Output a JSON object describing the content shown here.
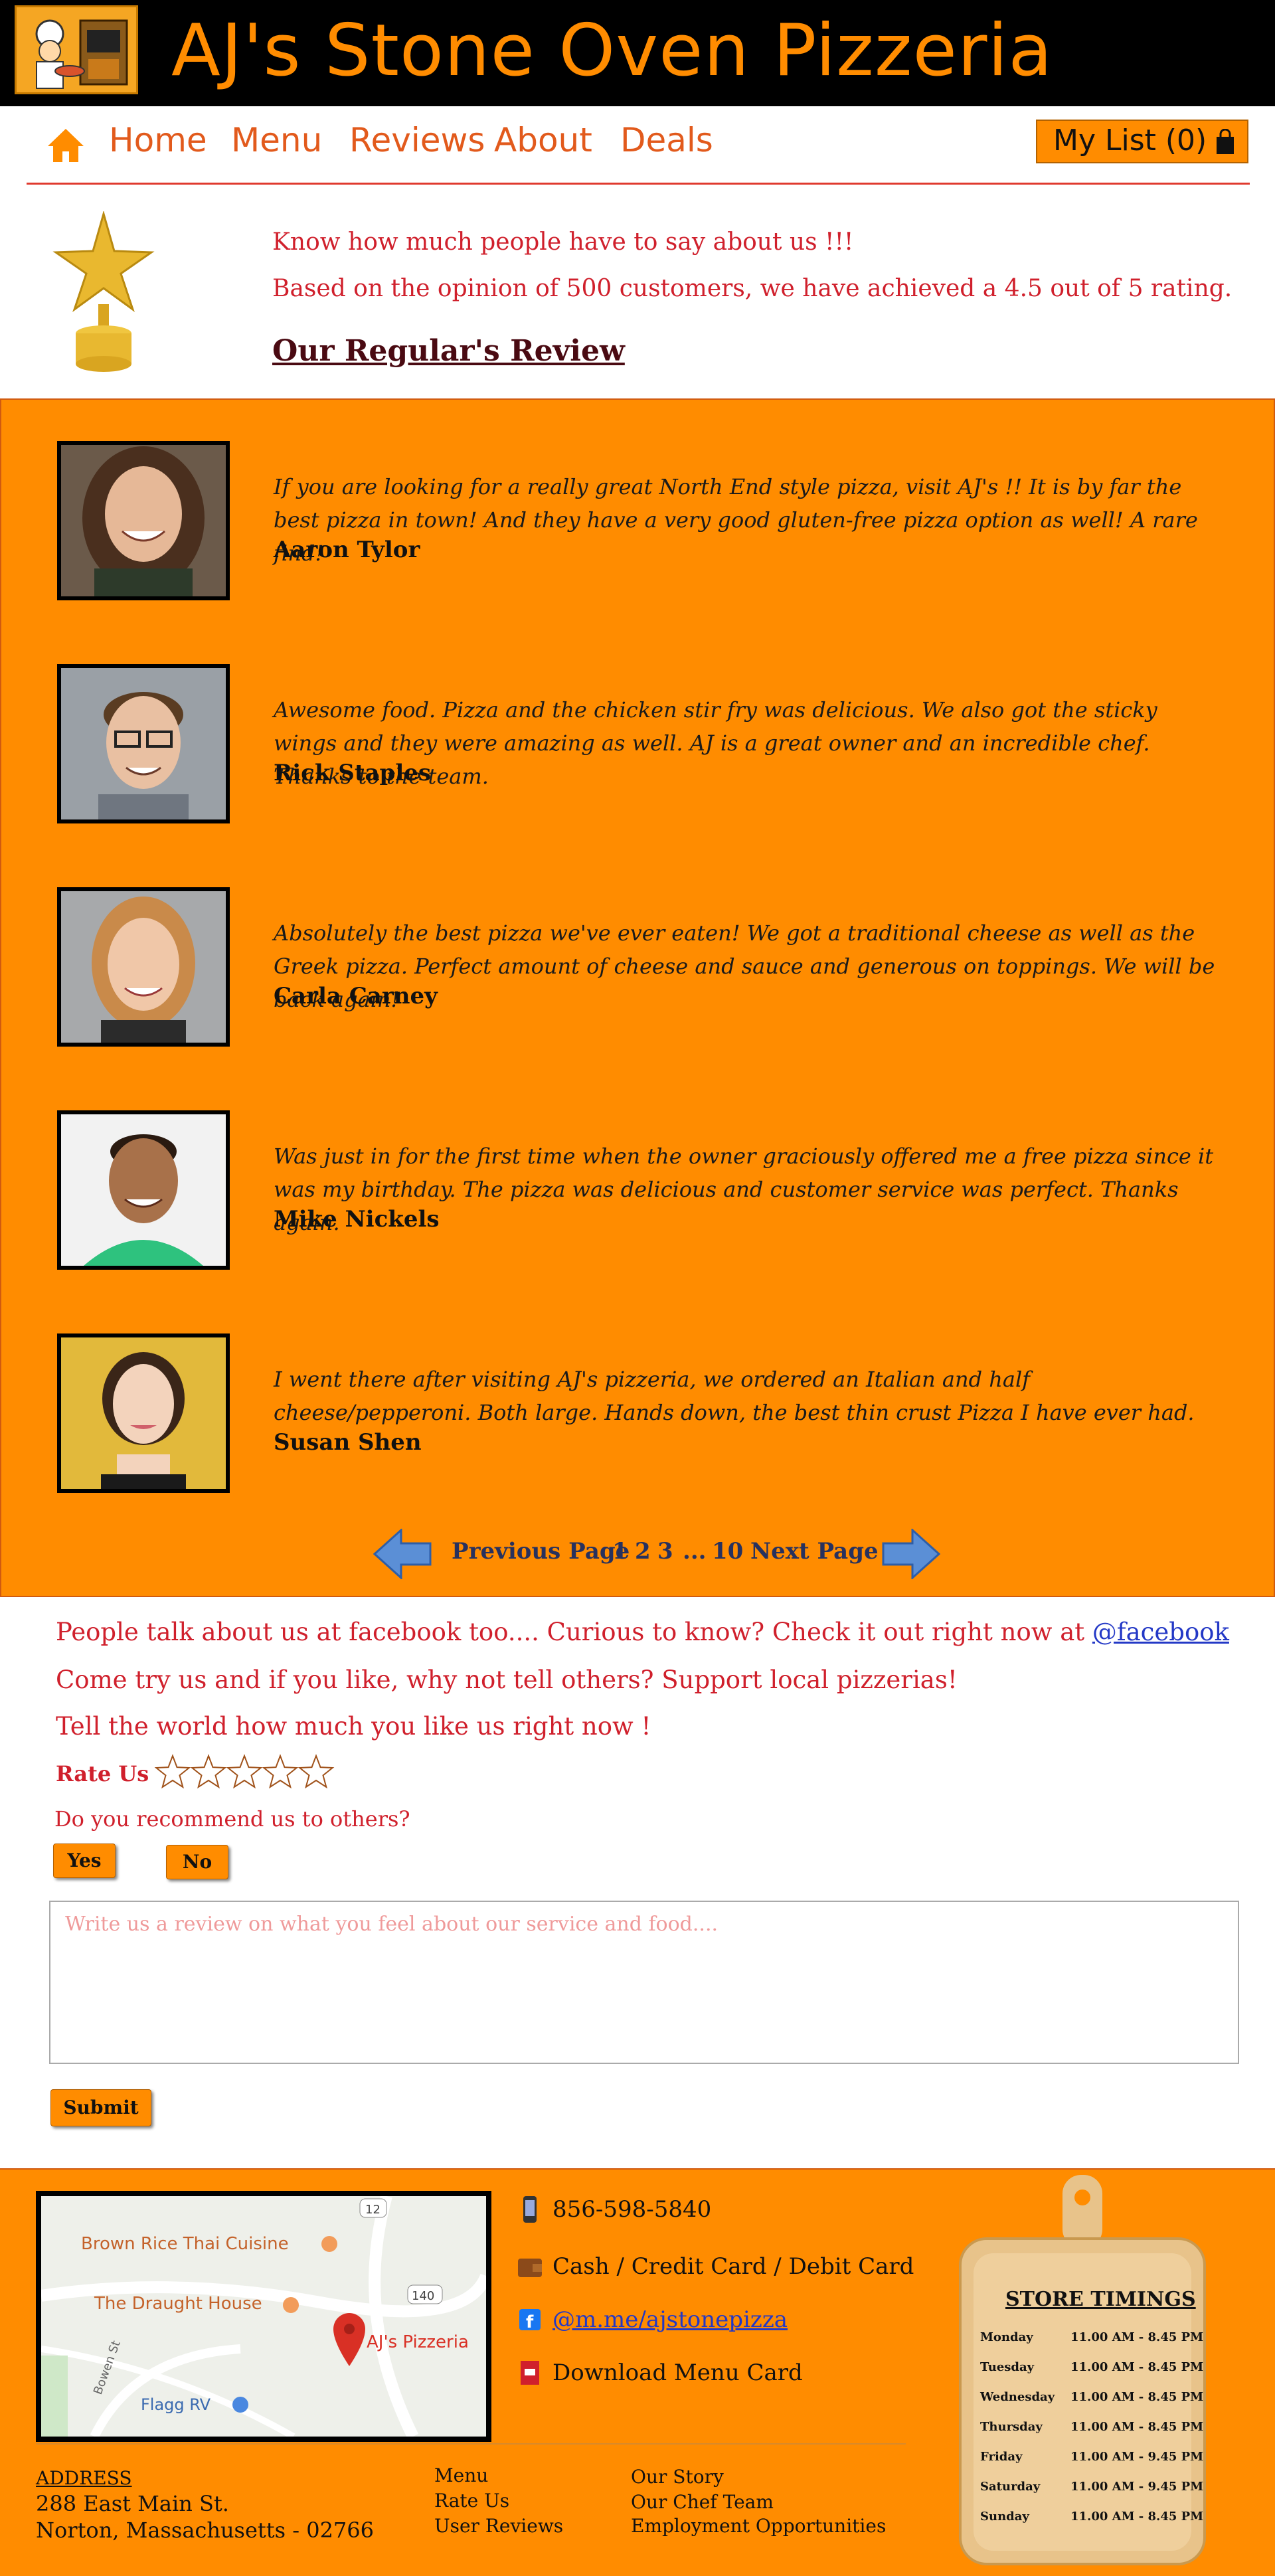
{
  "header": {
    "title": "AJ's Stone Oven Pizzeria"
  },
  "nav": {
    "items": [
      {
        "label": "Home"
      },
      {
        "label": "Menu"
      },
      {
        "label": "Reviews"
      },
      {
        "label": "About"
      },
      {
        "label": "Deals"
      }
    ],
    "my_list_label": "My List (0)"
  },
  "intro": {
    "line1": "Know how much people have to say about us !!!",
    "line2": "Based on the opinion of 500 customers, we have achieved a 4.5 out of 5 rating.",
    "section_title": "Our Regular's Review"
  },
  "reviews": [
    {
      "text": "If you are looking for a really great North End style pizza, visit AJ's !! It is by far the best pizza in town! And they have a very good gluten-free pizza option as well! A rare find!",
      "name": "Aaron Tylor"
    },
    {
      "text": "Awesome food. Pizza and the chicken stir fry was delicious. We also got the sticky wings and they were amazing as well. AJ is a great owner and an incredible chef. Thanks to the team.",
      "name": "Rick Staples"
    },
    {
      "text": "Absolutely the best pizza we've ever eaten! We got a traditional cheese as well as the Greek pizza. Perfect amount of cheese and sauce and generous on toppings. We will be back again!",
      "name": "Carla Carney"
    },
    {
      "text": "Was just in for the first time when the owner graciously offered me a free pizza since it was my birthday. The pizza was delicious and customer service was perfect. Thanks again.",
      "name": "Mike Nickels"
    },
    {
      "text": "I went there after visiting AJ's pizzeria, we ordered an Italian and half cheese/pepperoni. Both large. Hands down, the best thin crust Pizza I have ever had.",
      "name": "Susan Shen"
    }
  ],
  "pagination": {
    "previous": "Previous Page",
    "pages": [
      "1",
      "2",
      "3",
      "...",
      "10"
    ],
    "next": "Next Page"
  },
  "feedback": {
    "facebook_line": "People talk about us at facebook too.... Curious to know? Check it out right now at",
    "facebook_link": "@facebook",
    "support_line": "Come try us and if you like, why not tell others? Support local pizzerias!",
    "tell_line": "Tell the world how much you like us right now !",
    "rate_label": "Rate Us",
    "rating_value": 0,
    "rating_max": 5,
    "recommend_question": "Do you recommend us to others?",
    "yes_label": "Yes",
    "no_label": "No",
    "review_placeholder": "Write us a review on what you feel about our service and food....",
    "submit_label": "Submit"
  },
  "footer": {
    "map_labels": {
      "place1": "Brown Rice Thai Cuisine",
      "place2": "The Draught House",
      "place3": "AJ's Pizzeria",
      "place4": "Flagg RV",
      "street": "Bowen St",
      "route1": "12",
      "route2": "140"
    },
    "phone": "856-598-5840",
    "payment": "Cash / Credit Card / Debit Card",
    "facebook_handle": "@m.me/ajstonepizza",
    "download_menu": "Download Menu Card",
    "address_label": "ADDRESS",
    "address_line1": "288 East Main St.",
    "address_line2": "Norton, Massachusetts - 02766",
    "links_col1": [
      "Menu",
      "Rate Us",
      "User Reviews"
    ],
    "links_col2": [
      "Our Story",
      "Our Chef Team",
      "Employment Opportunities"
    ],
    "timings_title": "STORE TIMINGS",
    "timings": [
      {
        "day": "Monday",
        "hours": "11.00 AM - 8.45 PM"
      },
      {
        "day": "Tuesday",
        "hours": "11.00 AM - 8.45 PM"
      },
      {
        "day": "Wednesday",
        "hours": "11.00 AM - 8.45 PM"
      },
      {
        "day": "Thursday",
        "hours": "11.00 AM - 8.45 PM"
      },
      {
        "day": "Friday",
        "hours": "11.00 AM - 9.45 PM"
      },
      {
        "day": "Saturday",
        "hours": "11.00 AM - 9.45 PM"
      },
      {
        "day": "Sunday",
        "hours": "11.00 AM - 8.45 PM"
      }
    ]
  },
  "colors": {
    "brand_orange": "#ff8c00",
    "header_bg": "#000000",
    "accent_red": "#d0202c",
    "link_blue": "#2338c6"
  }
}
